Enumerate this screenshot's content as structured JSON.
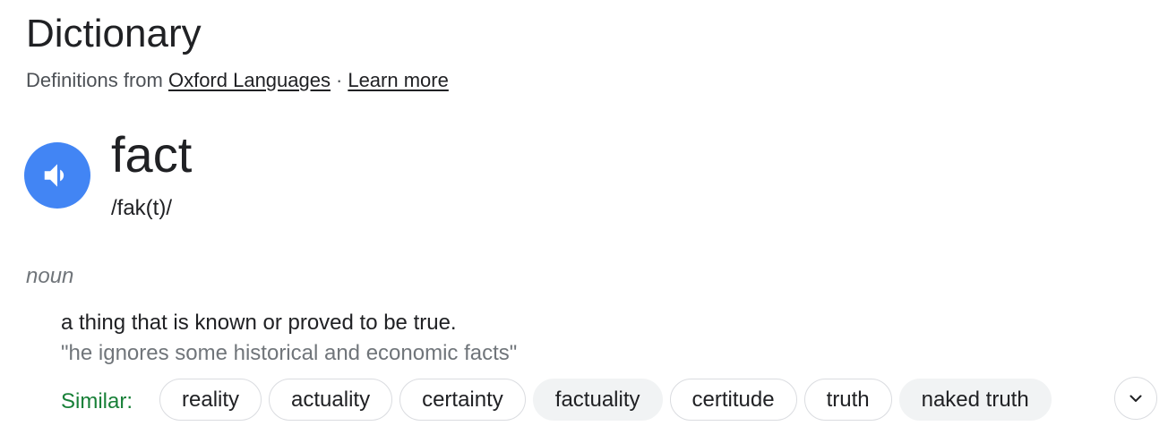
{
  "header": {
    "title": "Dictionary",
    "source_prefix": "Definitions from",
    "source_link": "Oxford Languages",
    "separator": "·",
    "learn_more": "Learn more"
  },
  "entry": {
    "word": "fact",
    "phonetic": "/fak(t)/",
    "audio_icon": "speaker-icon",
    "part_of_speech": "noun",
    "definition": "a thing that is known or proved to be true.",
    "example": "\"he ignores some historical and economic facts\""
  },
  "similar": {
    "label": "Similar:",
    "words": [
      {
        "label": "reality",
        "filled": false
      },
      {
        "label": "actuality",
        "filled": false
      },
      {
        "label": "certainty",
        "filled": false
      },
      {
        "label": "factuality",
        "filled": true
      },
      {
        "label": "certitude",
        "filled": false
      },
      {
        "label": "truth",
        "filled": false
      },
      {
        "label": "naked truth",
        "filled": true
      }
    ],
    "expand_icon": "chevron-down-icon"
  },
  "colors": {
    "accent_blue": "#4285f4",
    "similar_green": "#188038",
    "secondary_text": "#70757a",
    "chip_border": "#dadce0",
    "chip_filled": "#f1f3f4"
  }
}
